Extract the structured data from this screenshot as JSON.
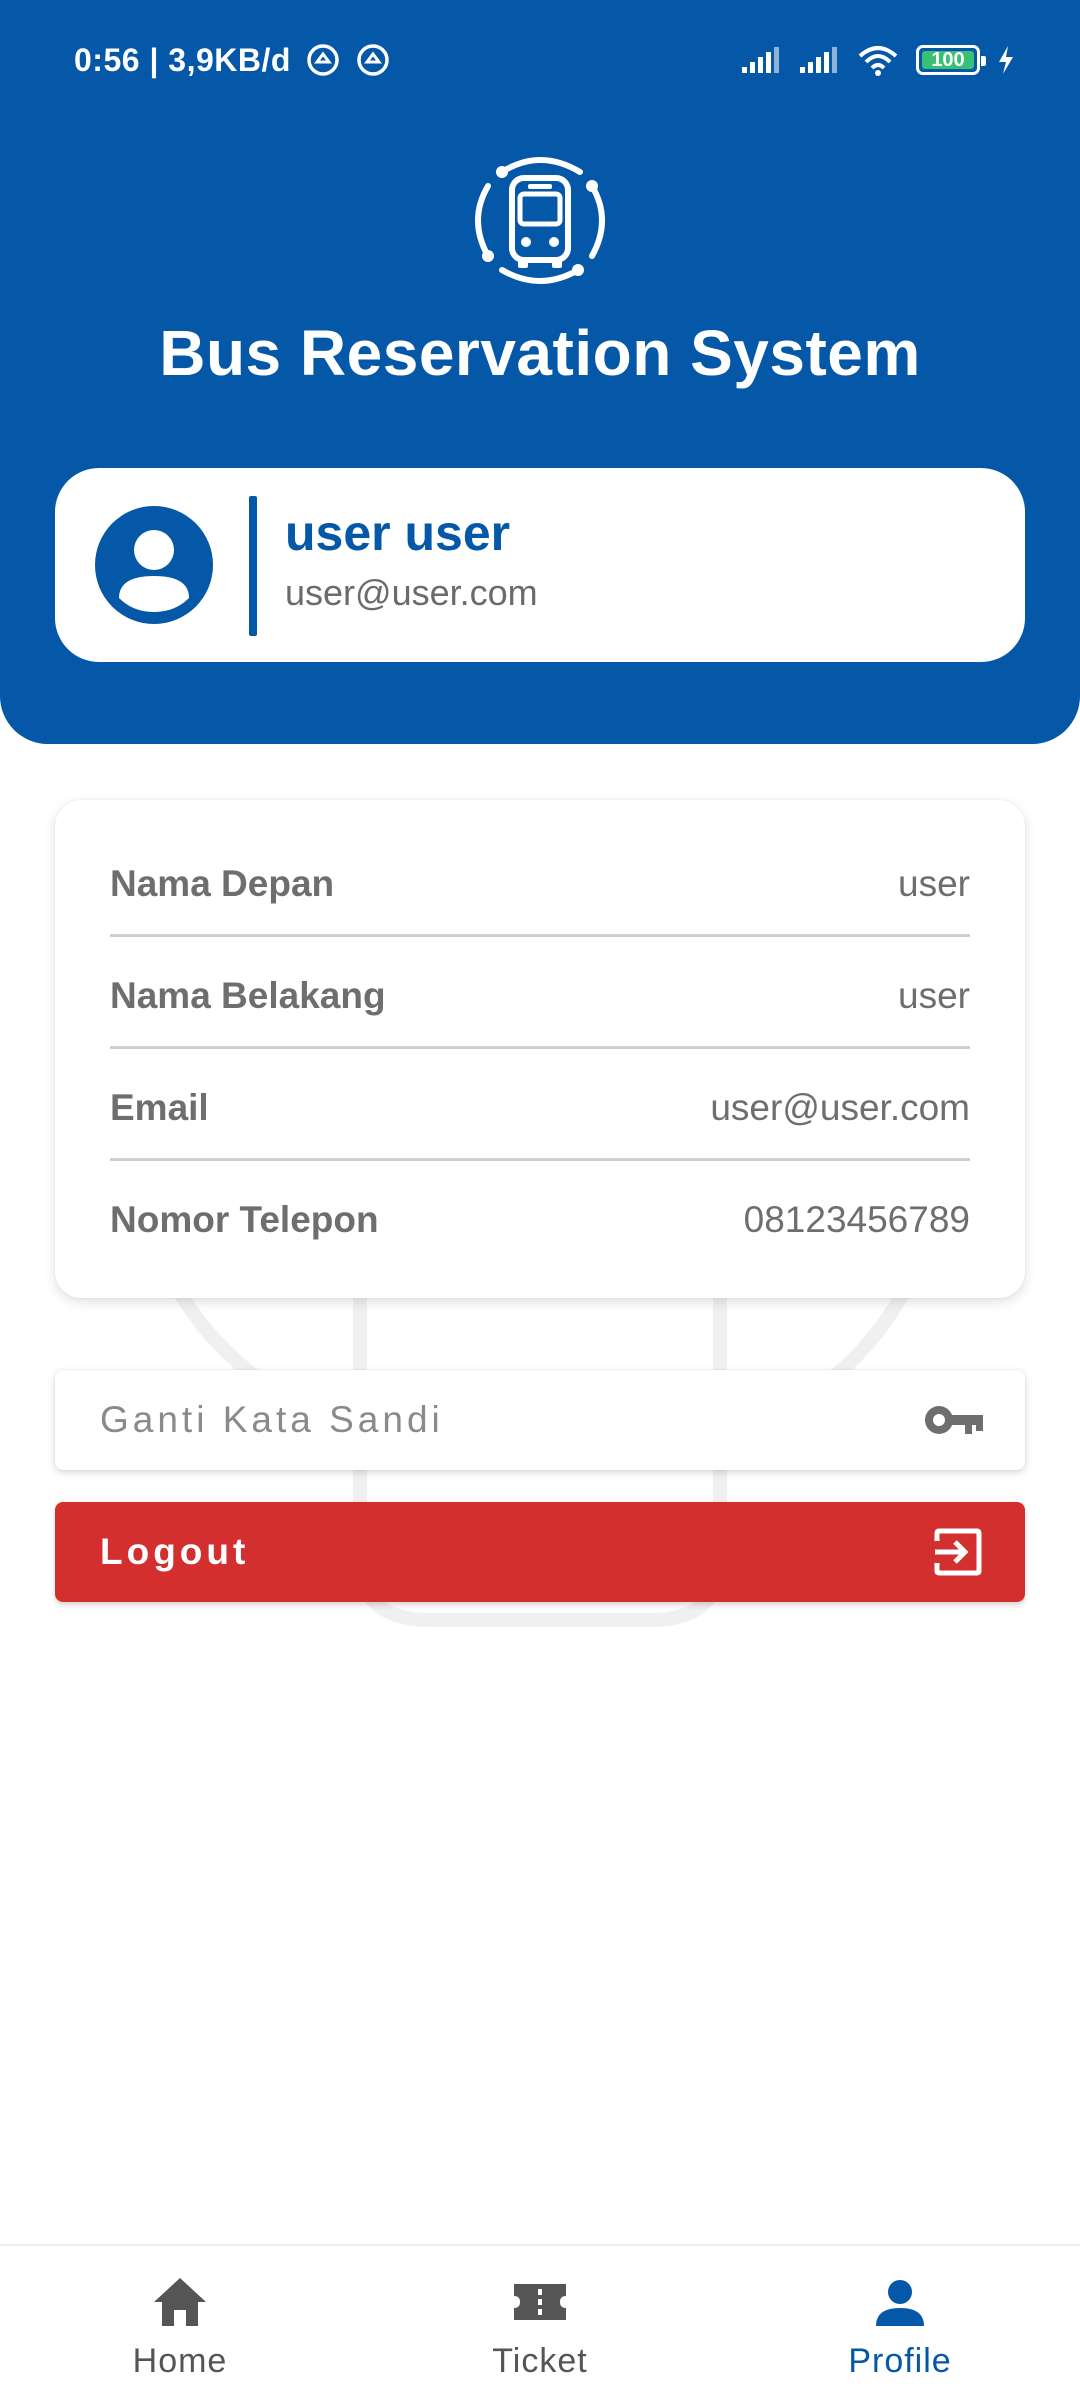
{
  "status_bar": {
    "time_speed": "0:56 | 3,9KB/d",
    "battery": "100"
  },
  "header": {
    "title": "Bus Reservation System"
  },
  "user": {
    "name": "user user",
    "email": "user@user.com"
  },
  "info": {
    "rows": [
      {
        "label": "Nama Depan",
        "value": "user"
      },
      {
        "label": "Nama Belakang",
        "value": "user"
      },
      {
        "label": "Email",
        "value": "user@user.com"
      },
      {
        "label": "Nomor Telepon",
        "value": "08123456789"
      }
    ]
  },
  "actions": {
    "change_password": "Ganti Kata Sandi",
    "logout": "Logout"
  },
  "nav": {
    "items": [
      {
        "label": "Home",
        "icon": "home-icon"
      },
      {
        "label": "Ticket",
        "icon": "ticket-icon"
      },
      {
        "label": "Profile",
        "icon": "person-icon"
      }
    ],
    "active": "Profile"
  },
  "colors": {
    "primary": "#0557A8",
    "danger": "#D32F2F",
    "text_muted": "#6e6e6e"
  }
}
